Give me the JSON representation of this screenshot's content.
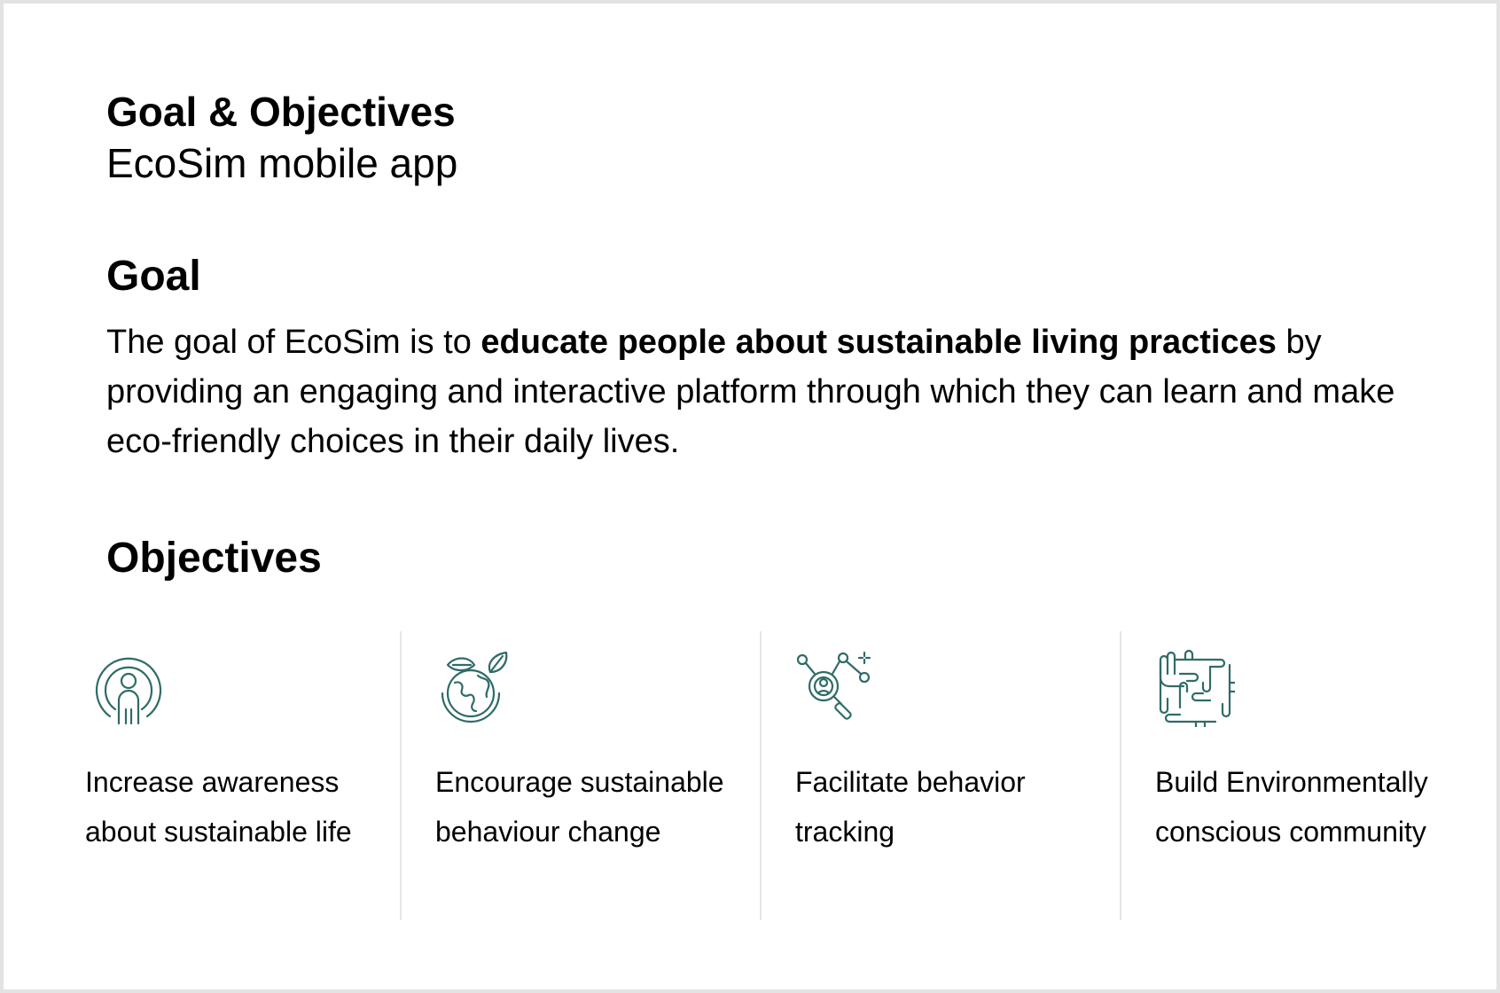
{
  "header": {
    "title": "Goal & Objectives",
    "subtitle": "EcoSim mobile app"
  },
  "goal": {
    "heading": "Goal",
    "text_before": "The goal of EcoSim is to ",
    "text_bold": "educate people about sustainable living practices",
    "text_after": " by providing an engaging and interactive platform through which they can learn and make eco-friendly choices in their daily lives."
  },
  "objectives": {
    "heading": "Objectives",
    "items": [
      {
        "icon": "person-radar-icon",
        "line1": "Increase awareness",
        "line2": "about sustainable life"
      },
      {
        "icon": "globe-leaves-icon",
        "line1": "Encourage sustainable",
        "line2": "behaviour change"
      },
      {
        "icon": "magnifier-network-icon",
        "line1": "Facilitate behavior",
        "line2": "tracking"
      },
      {
        "icon": "hands-together-icon",
        "line1": "Build Environmentally",
        "line2": "conscious community"
      }
    ]
  },
  "colors": {
    "icon": "#2f6b68",
    "divider": "#e6e6e6",
    "frame": "#e3e3e3"
  }
}
